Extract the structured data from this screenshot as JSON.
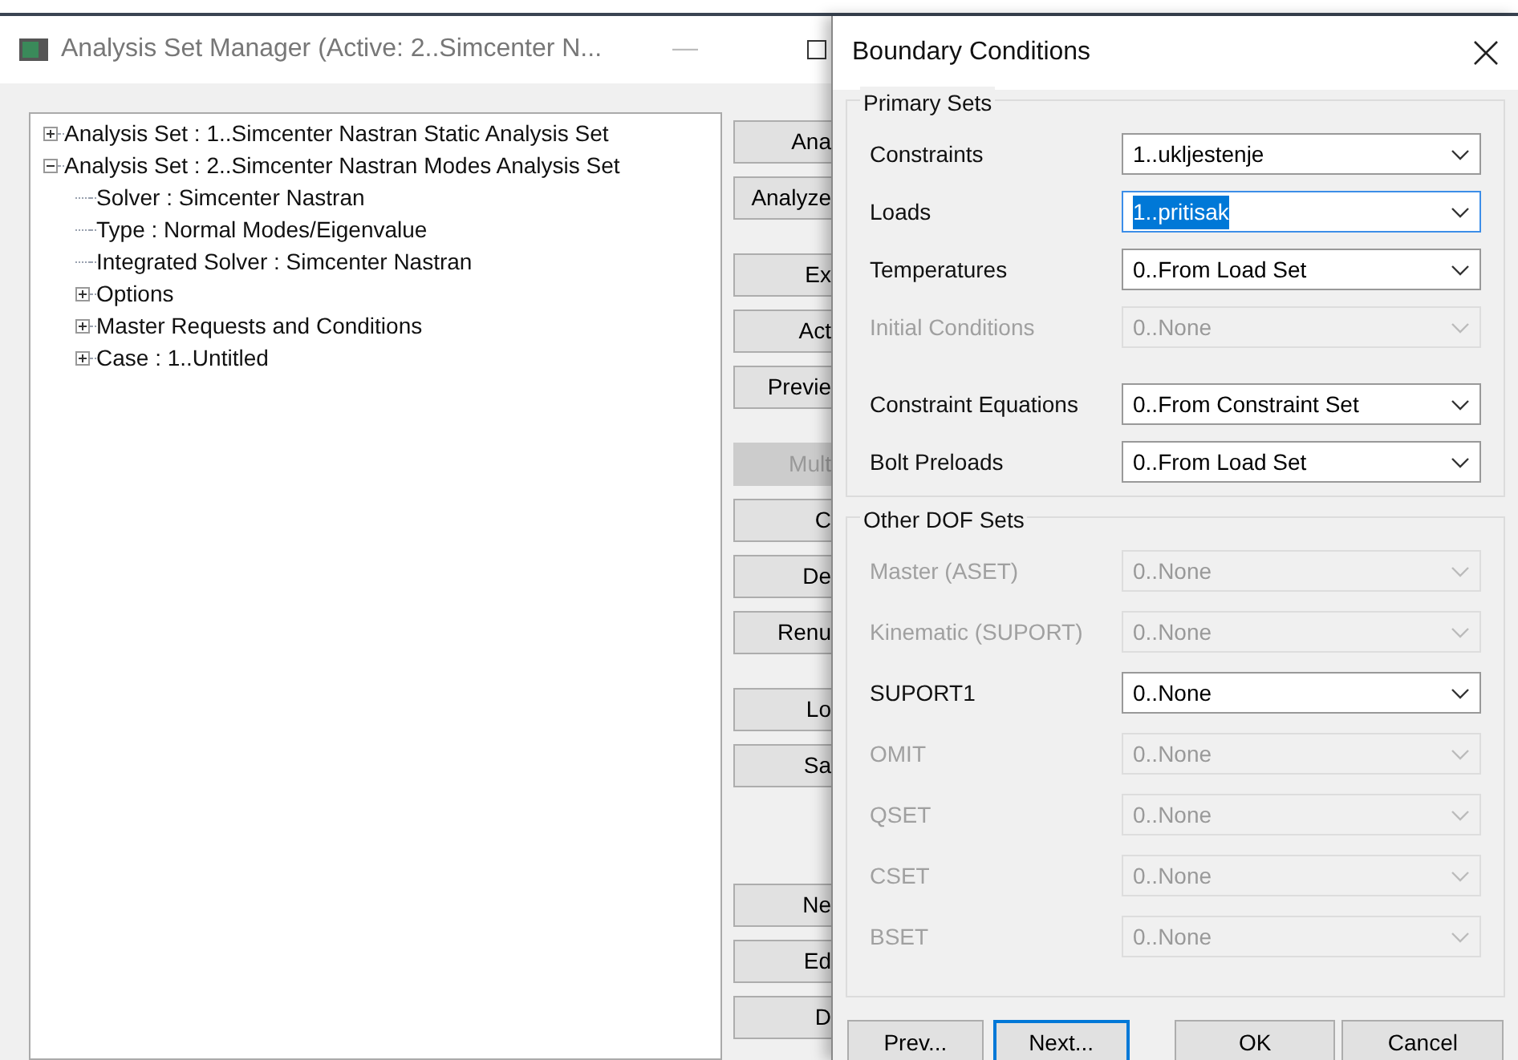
{
  "window": {
    "title": "Analysis Set Manager (Active: 2..Simcenter N...",
    "minimize": "—"
  },
  "tree": [
    {
      "label": "Analysis Set : 1..Simcenter Nastran Static Analysis Set",
      "expanded": false
    },
    {
      "label": "Analysis Set : 2..Simcenter Nastran Modes Analysis Set",
      "expanded": true,
      "children": [
        {
          "label": "Solver : Simcenter Nastran"
        },
        {
          "label": "Type : Normal Modes/Eigenvalue"
        },
        {
          "label": "Integrated Solver : Simcenter Nastran"
        },
        {
          "label": "Options",
          "expanded": false
        },
        {
          "label": "Master Requests and Conditions",
          "expanded": false
        },
        {
          "label": "Case : 1..Untitled",
          "expanded": false
        }
      ]
    }
  ],
  "side_button_groups": [
    [
      {
        "label": "Ana",
        "disabled": false
      },
      {
        "label": "Analyze",
        "disabled": false
      }
    ],
    [
      {
        "label": "Ex",
        "disabled": false
      },
      {
        "label": "Act",
        "disabled": false
      },
      {
        "label": "Previe",
        "disabled": false
      }
    ],
    [
      {
        "label": "Mult",
        "disabled": true
      },
      {
        "label": "C",
        "disabled": false
      },
      {
        "label": "De",
        "disabled": false
      },
      {
        "label": "Renu",
        "disabled": false
      }
    ],
    [
      {
        "label": "Lo",
        "disabled": false
      },
      {
        "label": "Sa",
        "disabled": false
      }
    ],
    [
      {
        "label": "Ne",
        "disabled": false
      },
      {
        "label": "Ed",
        "disabled": false
      },
      {
        "label": "D",
        "disabled": false
      }
    ]
  ],
  "dialog": {
    "title": "Boundary Conditions",
    "groups": [
      {
        "title": "Primary Sets",
        "blocks": [
          [
            {
              "label": "Constraints",
              "value": "1..ukljestenje",
              "disabled": false,
              "focused": false
            },
            {
              "label": "Loads",
              "value": "1..pritisak",
              "disabled": false,
              "focused": true
            },
            {
              "label": "Temperatures",
              "value": "0..From Load Set",
              "disabled": false,
              "focused": false
            },
            {
              "label": "Initial Conditions",
              "value": "0..None",
              "disabled": true,
              "focused": false
            }
          ],
          [
            {
              "label": "Constraint Equations",
              "value": "0..From Constraint Set",
              "disabled": false,
              "focused": false
            },
            {
              "label": "Bolt Preloads",
              "value": "0..From Load Set",
              "disabled": false,
              "focused": false
            }
          ]
        ]
      },
      {
        "title": "Other DOF Sets",
        "blocks": [
          [
            {
              "label": "Master (ASET)",
              "value": "0..None",
              "disabled": true,
              "focused": false
            },
            {
              "label": "Kinematic (SUPORT)",
              "value": "0..None",
              "disabled": true,
              "focused": false
            },
            {
              "label": "SUPORT1",
              "value": "0..None",
              "disabled": false,
              "focused": false
            },
            {
              "label": "OMIT",
              "value": "0..None",
              "disabled": true,
              "focused": false
            },
            {
              "label": "QSET",
              "value": "0..None",
              "disabled": true,
              "focused": false
            },
            {
              "label": "CSET",
              "value": "0..None",
              "disabled": true,
              "focused": false
            },
            {
              "label": "BSET",
              "value": "0..None",
              "disabled": true,
              "focused": false
            }
          ]
        ]
      }
    ],
    "buttons": [
      {
        "label": "Prev...",
        "default": false
      },
      {
        "label": "Next...",
        "default": true
      },
      {
        "label": "OK",
        "default": false
      },
      {
        "label": "Cancel",
        "default": false
      }
    ]
  }
}
